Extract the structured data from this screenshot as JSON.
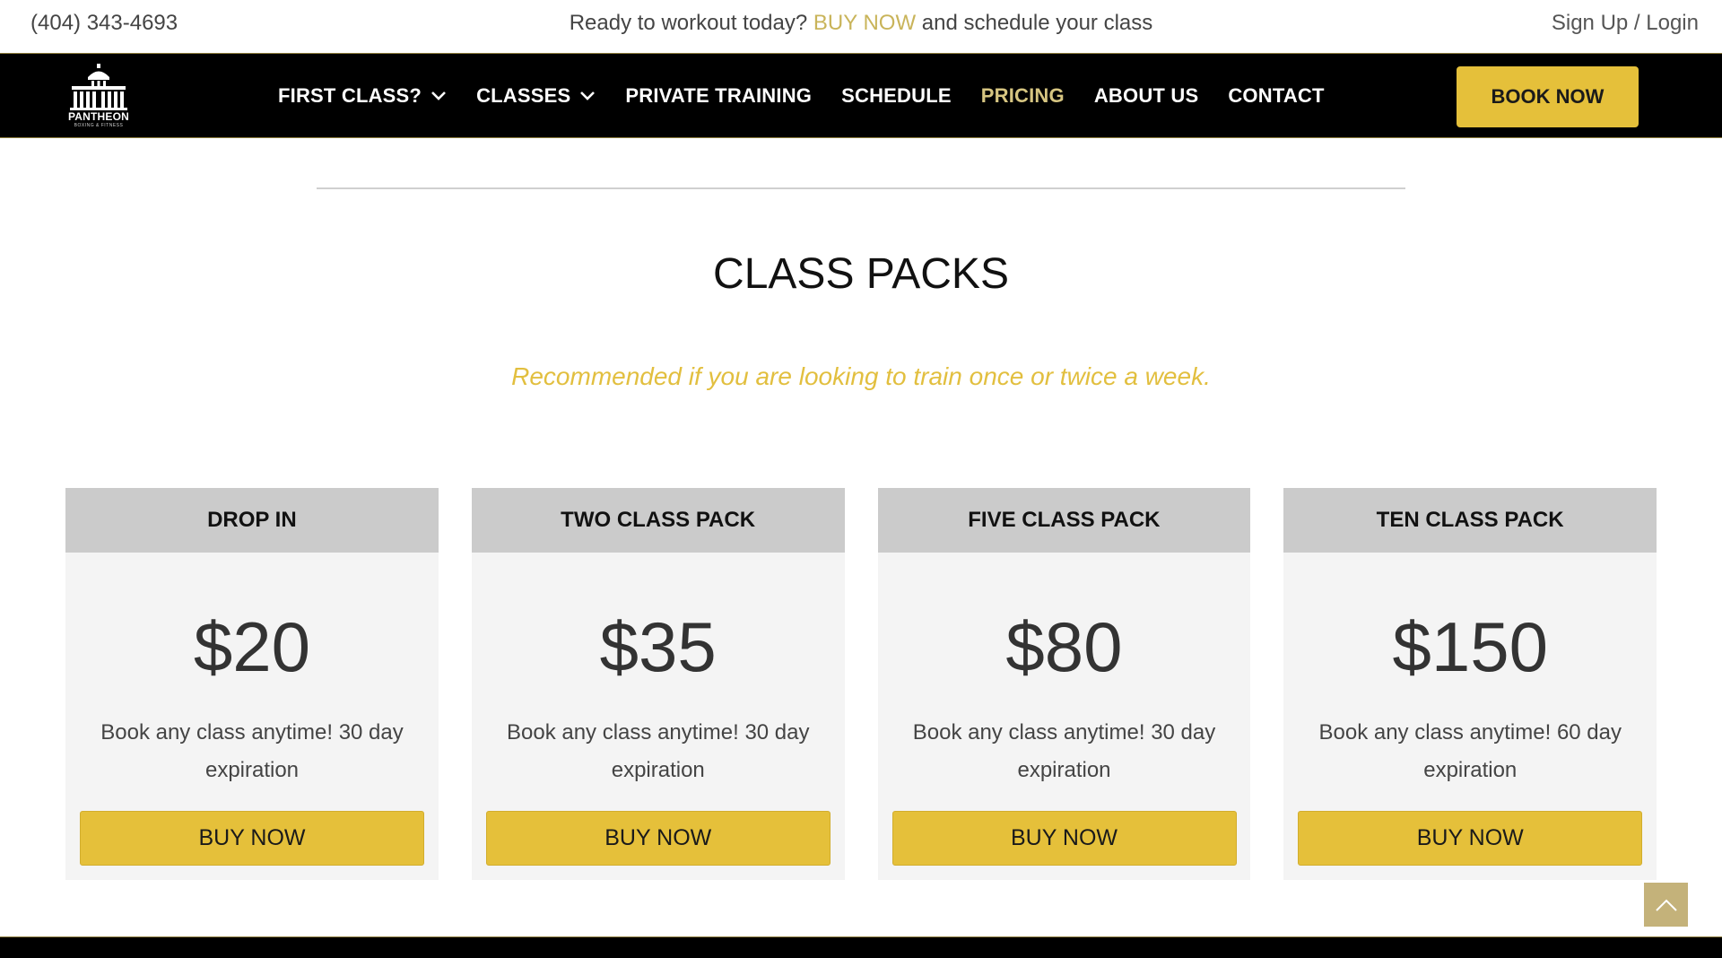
{
  "topbar": {
    "phone": "(404) 343-4693",
    "promo_prefix": "Ready to workout today? ",
    "promo_link": "BUY NOW",
    "promo_suffix": " and schedule your class",
    "signup": "Sign Up",
    "separator": " / ",
    "login": "Login"
  },
  "logo": {
    "name": "PANTHEON",
    "tagline": "BOXING & FITNESS"
  },
  "nav": {
    "items": [
      {
        "label": "FIRST CLASS?",
        "dropdown": true
      },
      {
        "label": "CLASSES",
        "dropdown": true
      },
      {
        "label": "PRIVATE TRAINING",
        "dropdown": false
      },
      {
        "label": "SCHEDULE",
        "dropdown": false
      },
      {
        "label": "PRICING",
        "dropdown": false,
        "active": true
      },
      {
        "label": "ABOUT US",
        "dropdown": false
      },
      {
        "label": "CONTACT",
        "dropdown": false
      }
    ],
    "book_button": "BOOK NOW"
  },
  "section": {
    "title": "CLASS PACKS",
    "subtitle": "Recommended if you are looking to train once or twice a week."
  },
  "cards": [
    {
      "title": "DROP IN",
      "price": "$20",
      "desc": "Book any class anytime! 30 day expiration",
      "button": "BUY NOW"
    },
    {
      "title": "TWO CLASS PACK",
      "price": "$35",
      "desc": "Book any class anytime! 30 day expiration",
      "button": "BUY NOW"
    },
    {
      "title": "FIVE CLASS PACK",
      "price": "$80",
      "desc": "Book any class anytime! 30 day expiration",
      "button": "BUY NOW"
    },
    {
      "title": "TEN CLASS PACK",
      "price": "$150",
      "desc": "Book any class anytime! 60 day expiration",
      "button": "BUY NOW"
    }
  ],
  "icons": {
    "scroll_top": "chevron-up-icon",
    "dropdown": "chevron-down-icon"
  },
  "colors": {
    "accent": "#e5c03a",
    "active_nav": "#d6c581",
    "navbar_bg": "#000000",
    "card_header_bg": "#cbcbcb"
  }
}
